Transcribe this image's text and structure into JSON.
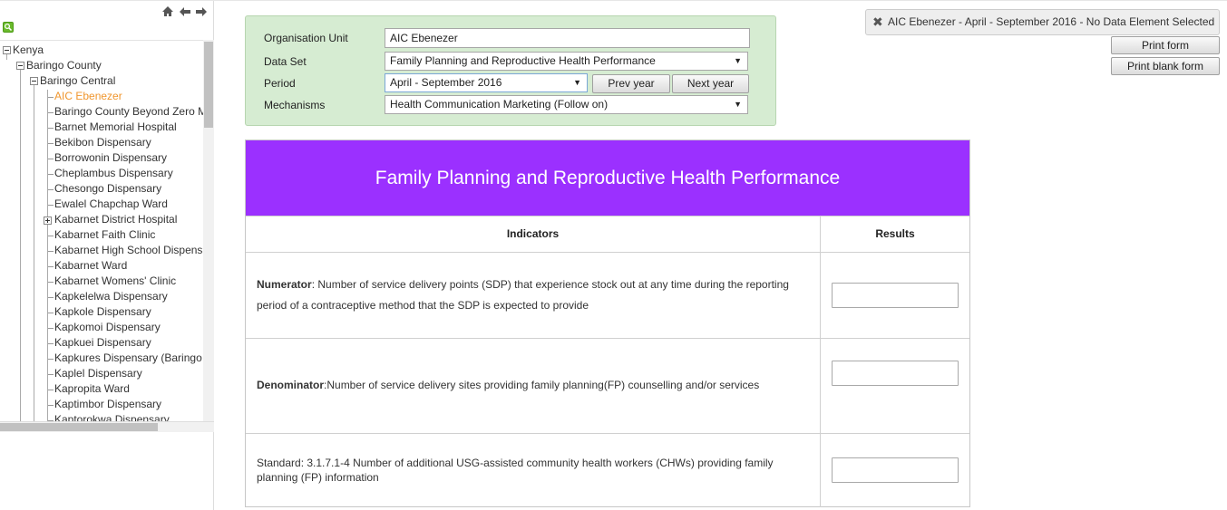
{
  "tree": {
    "items": [
      {
        "label": "Kenya",
        "level": 0,
        "toggle": "minus"
      },
      {
        "label": "Baringo County",
        "level": 1,
        "toggle": "minus"
      },
      {
        "label": "Baringo Central",
        "level": 2,
        "toggle": "minus"
      },
      {
        "label": "AIC Ebenezer",
        "level": 3,
        "selected": true
      },
      {
        "label": "Baringo County Beyond Zero M",
        "level": 3
      },
      {
        "label": "Barnet Memorial Hospital",
        "level": 3
      },
      {
        "label": "Bekibon Dispensary",
        "level": 3
      },
      {
        "label": "Borrowonin Dispensary",
        "level": 3
      },
      {
        "label": "Cheplambus Dispensary",
        "level": 3
      },
      {
        "label": "Chesongo Dispensary",
        "level": 3
      },
      {
        "label": "Ewalel Chapchap Ward",
        "level": 3
      },
      {
        "label": "Kabarnet District Hospital",
        "level": 3,
        "toggle": "plus"
      },
      {
        "label": "Kabarnet Faith Clinic",
        "level": 3
      },
      {
        "label": "Kabarnet High School Dispens",
        "level": 3
      },
      {
        "label": "Kabarnet Ward",
        "level": 3
      },
      {
        "label": "Kabarnet Womens' Clinic",
        "level": 3
      },
      {
        "label": "Kapkelelwa Dispensary",
        "level": 3
      },
      {
        "label": "Kapkole Dispensary",
        "level": 3
      },
      {
        "label": "Kapkomoi Dispensary",
        "level": 3
      },
      {
        "label": "Kapkuei Dispensary",
        "level": 3
      },
      {
        "label": "Kapkures Dispensary (Baringo",
        "level": 3
      },
      {
        "label": "Kaplel Dispensary",
        "level": 3
      },
      {
        "label": "Kapropita Ward",
        "level": 3
      },
      {
        "label": "Kaptimbor Dispensary",
        "level": 3
      },
      {
        "label": "Kaptorokwa Dispensary",
        "level": 3
      }
    ]
  },
  "criteria": {
    "org_unit_label": "Organisation Unit",
    "org_unit_value": "AIC Ebenezer",
    "data_set_label": "Data Set",
    "data_set_value": "Family Planning and Reproductive Health Performance",
    "period_label": "Period",
    "period_value": "April - September 2016",
    "prev_year": "Prev year",
    "next_year": "Next year",
    "mechanisms_label": "Mechanisms",
    "mechanisms_value": "Health Communication Marketing (Follow on)"
  },
  "info_bar": {
    "text": "AIC Ebenezer - April - September 2016 - No Data Element Selected"
  },
  "actions": {
    "print_form": "Print form",
    "print_blank_form": "Print blank form"
  },
  "form": {
    "title": "Family Planning and Reproductive Health Performance",
    "col_indicators": "Indicators",
    "col_results": "Results",
    "rows": [
      {
        "bold": "Numerator",
        "text": ":  Number of service delivery points (SDP) that experience stock out at any time during the reporting period of a contraceptive method that the SDP is expected to provide",
        "result": ""
      },
      {
        "bold": "Denominator",
        "text": ":Number of service delivery sites providing family planning(FP) counselling and/or services",
        "result": ""
      },
      {
        "bold": "",
        "text": "Standard: 3.1.7.1-4 Number of additional USG-assisted community health workers (CHWs) providing family planning (FP) information",
        "result": ""
      }
    ]
  },
  "colors": {
    "form_header_bg": "#9b30ff",
    "criteria_bg": "#d6ecd2",
    "selected_tree_item": "#f0962d"
  }
}
